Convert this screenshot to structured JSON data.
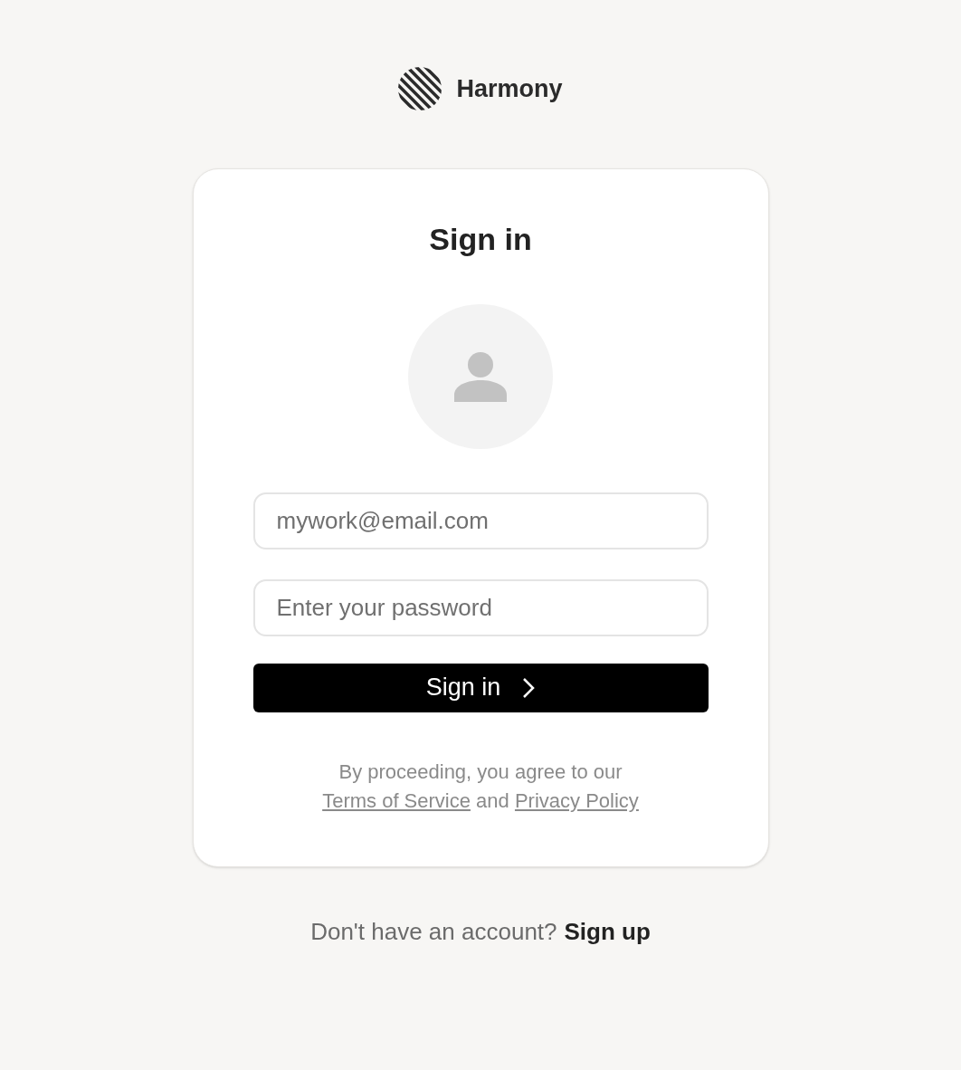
{
  "brand": {
    "name": "Harmony"
  },
  "card": {
    "title": "Sign in",
    "email": {
      "placeholder": "mywork@email.com"
    },
    "password": {
      "placeholder": "Enter your password"
    },
    "submit": {
      "label": "Sign in"
    },
    "terms": {
      "prefix": "By proceeding, you agree to our",
      "link_1": "Terms of Service",
      "middle": "and",
      "link_2": "Privacy Policy"
    }
  },
  "footer": {
    "question": "Don't have an account?",
    "link": "Sign up"
  }
}
